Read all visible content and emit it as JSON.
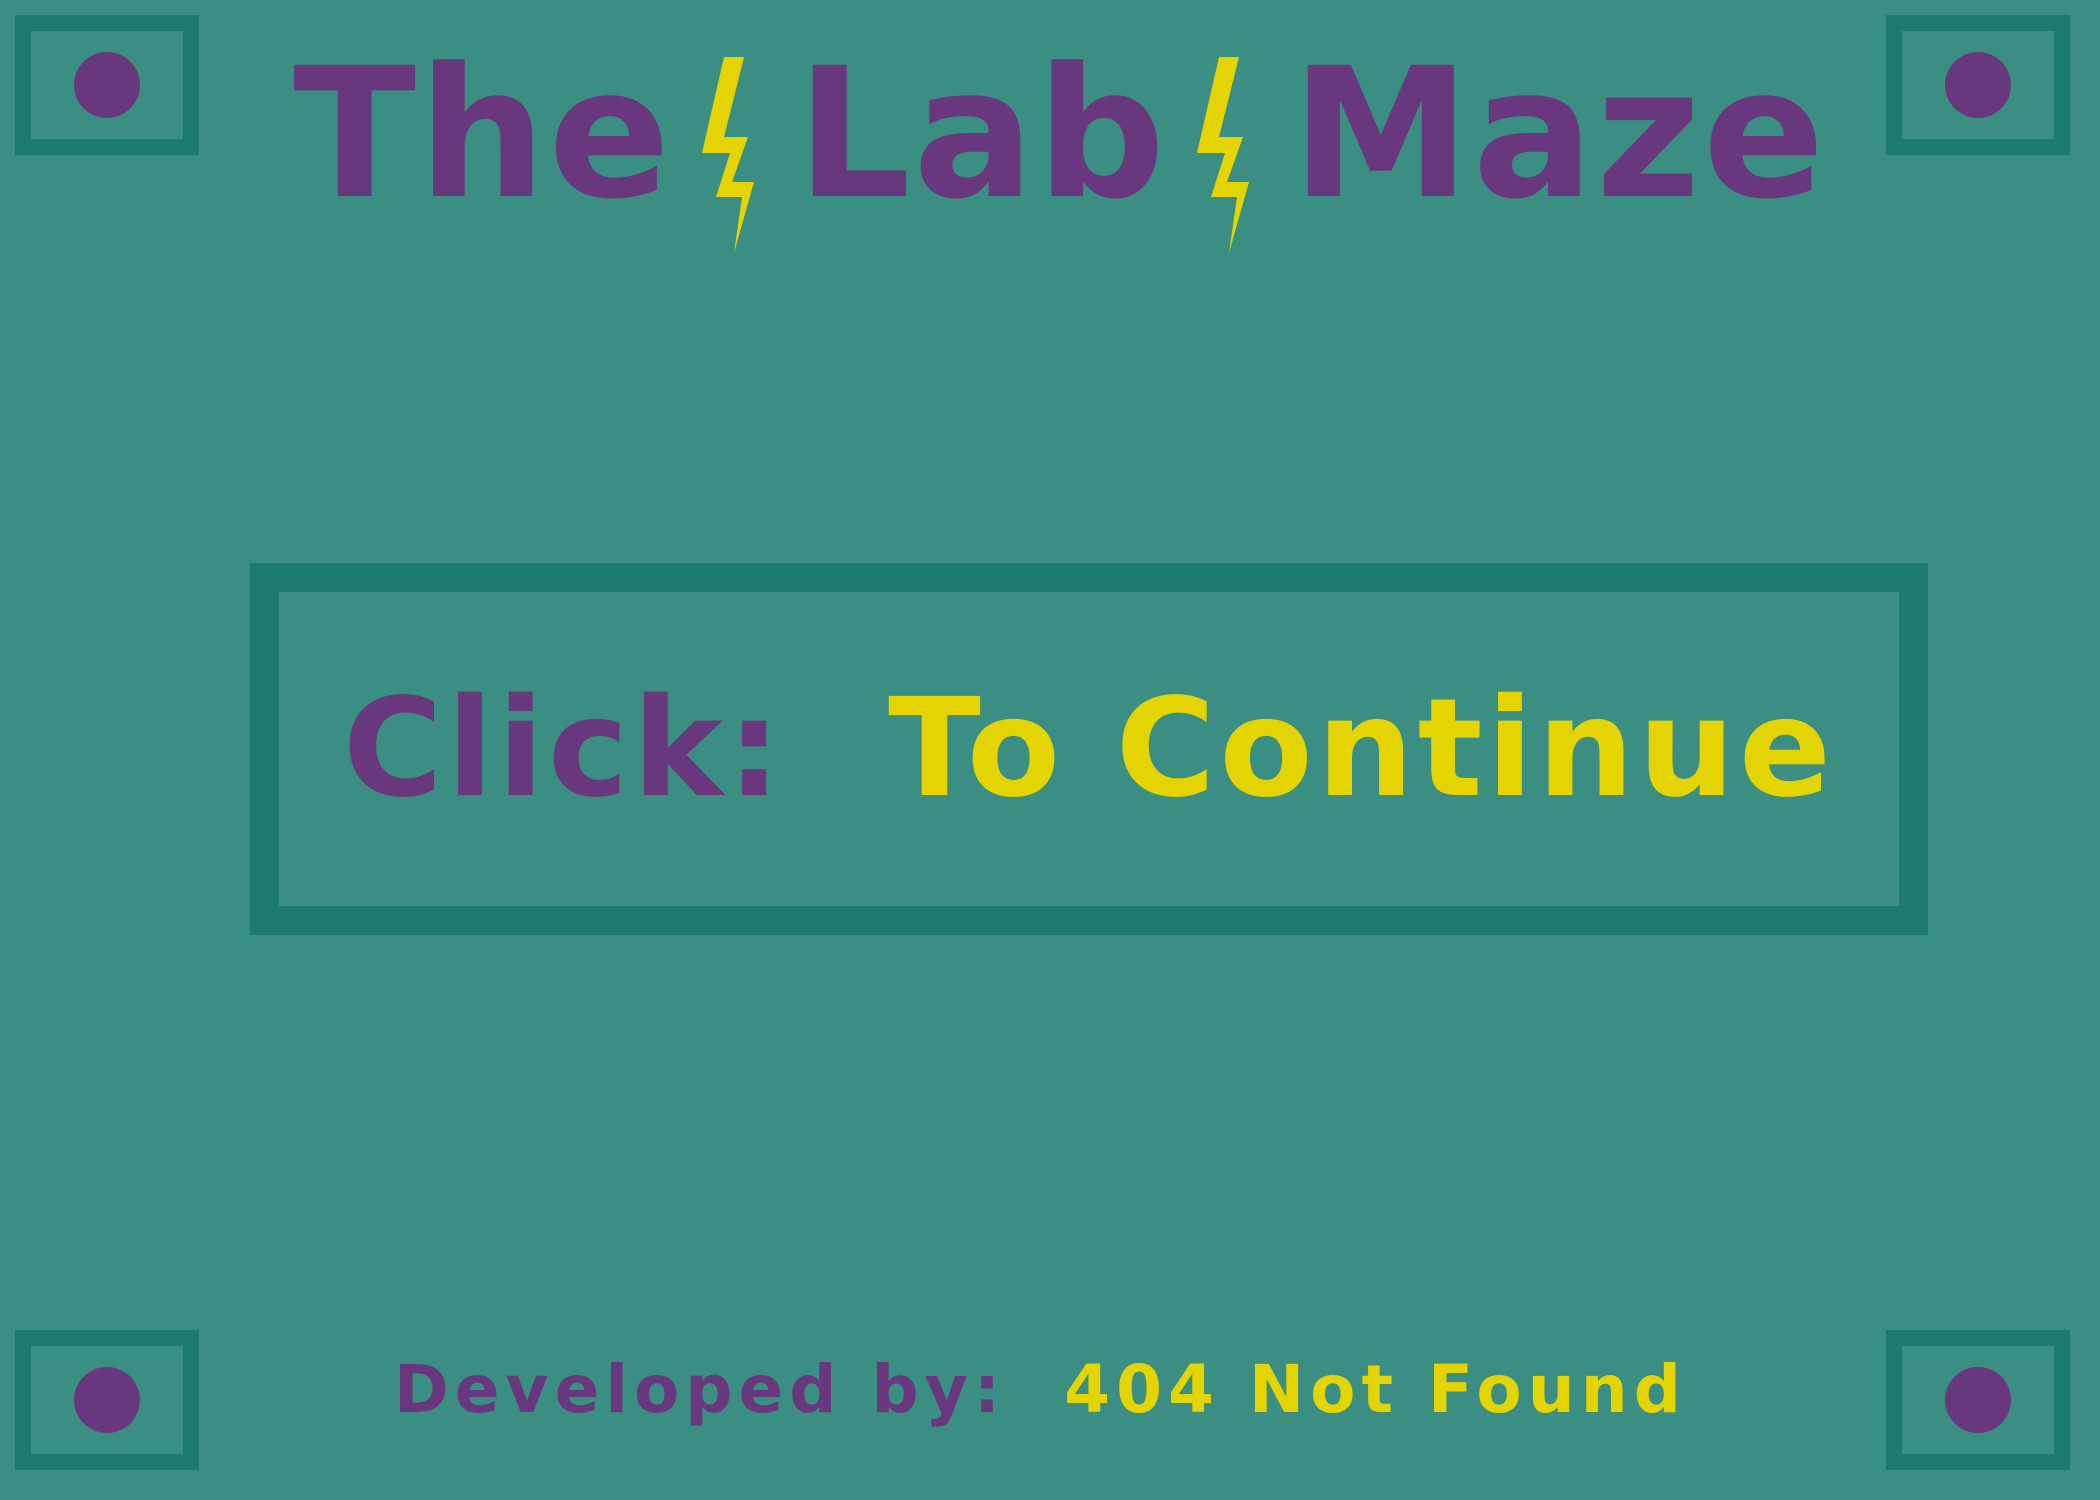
{
  "title": {
    "word_1": "The",
    "word_2": "Lab",
    "word_3": "Maze",
    "separator_icon": "lightning-bolt-icon"
  },
  "prompt": {
    "prefix": "Click:",
    "action": "To Continue"
  },
  "credits": {
    "label": "Developed by:",
    "developer": "404 Not Found"
  },
  "colors": {
    "background": "#3a8f82",
    "frame": "#1c7b6d",
    "purple": "#69377d",
    "yellow": "#e4d404"
  }
}
